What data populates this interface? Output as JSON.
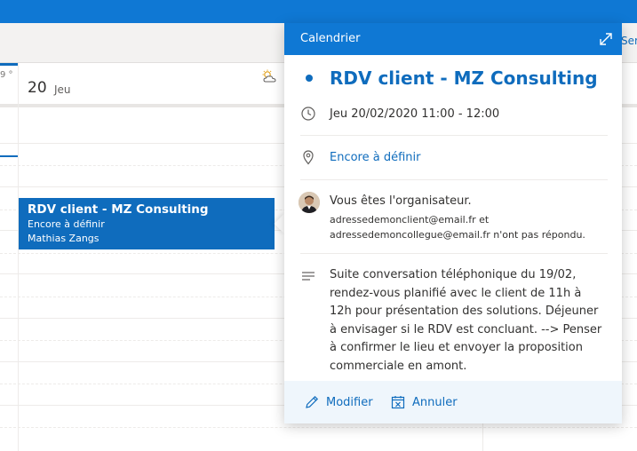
{
  "calendar": {
    "left_column_partial": "9 °",
    "day_number": "20",
    "day_name": "Jeu",
    "right_partial_label": "Ser",
    "weather_icon": "partly-cloudy-icon",
    "event": {
      "title": "RDV client - MZ Consulting",
      "location": "Encore à définir",
      "organizer": "Mathias Zangs",
      "color": "#0f6cbd"
    }
  },
  "popup": {
    "header_title": "Calendrier",
    "expand_icon": "expand-icon",
    "event_title": "RDV client - MZ Consulting",
    "datetime": "Jeu 20/02/2020 11:00 - 12:00",
    "location_link": "Encore à définir",
    "organizer_text": "Vous êtes l'organisateur.",
    "attendees_line1_email": "adressedemonclient@email.fr",
    "attendees_line1_suffix": " et",
    "attendees_line2_email": "adressedemoncollegue@email.fr",
    "attendees_line2_suffix": " n'ont pas répondu.",
    "description": "Suite conversation téléphonique du 19/02, rendez-vous planifié avec le client de 11h à 12h pour présentation des solutions. Déjeuner à envisager si le RDV est concluant. --> Penser à confirmer le lieu et envoyer la proposition commerciale en amont.",
    "actions": {
      "edit_label": "Modifier",
      "cancel_label": "Annuler"
    }
  }
}
